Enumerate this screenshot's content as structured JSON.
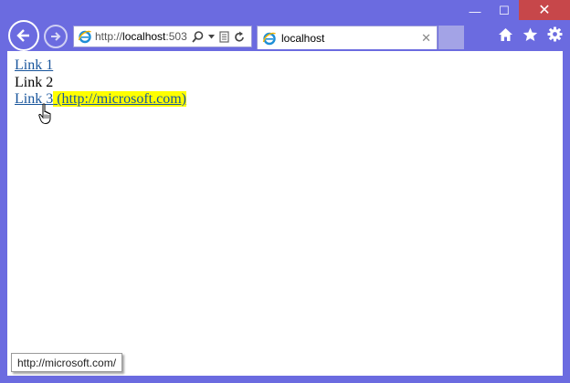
{
  "window": {
    "minimize_glyph": "—",
    "maximize_glyph": "☐",
    "close_glyph": "✕"
  },
  "addressbar": {
    "prefix": "http://",
    "host": "localhost",
    "suffix": ":503",
    "icons": [
      "ie-logo-icon",
      "search-icon",
      "dropdown-icon",
      "compat-view-icon",
      "refresh-icon"
    ]
  },
  "tab": {
    "title": "localhost",
    "close_glyph": "✕"
  },
  "toolbar": {
    "icons": [
      "home-icon",
      "favorites-star-icon",
      "settings-gear-icon"
    ]
  },
  "page": {
    "link1": "Link 1",
    "text2": "Link 2",
    "link3": "Link 3",
    "link3_annotation": " (http://microsoft.com)"
  },
  "statusbar": {
    "url": "http://microsoft.com/"
  },
  "colors": {
    "frame": "#6b6be0",
    "close_button": "#c7474a",
    "link": "#17549b",
    "highlight": "#ffff00"
  }
}
